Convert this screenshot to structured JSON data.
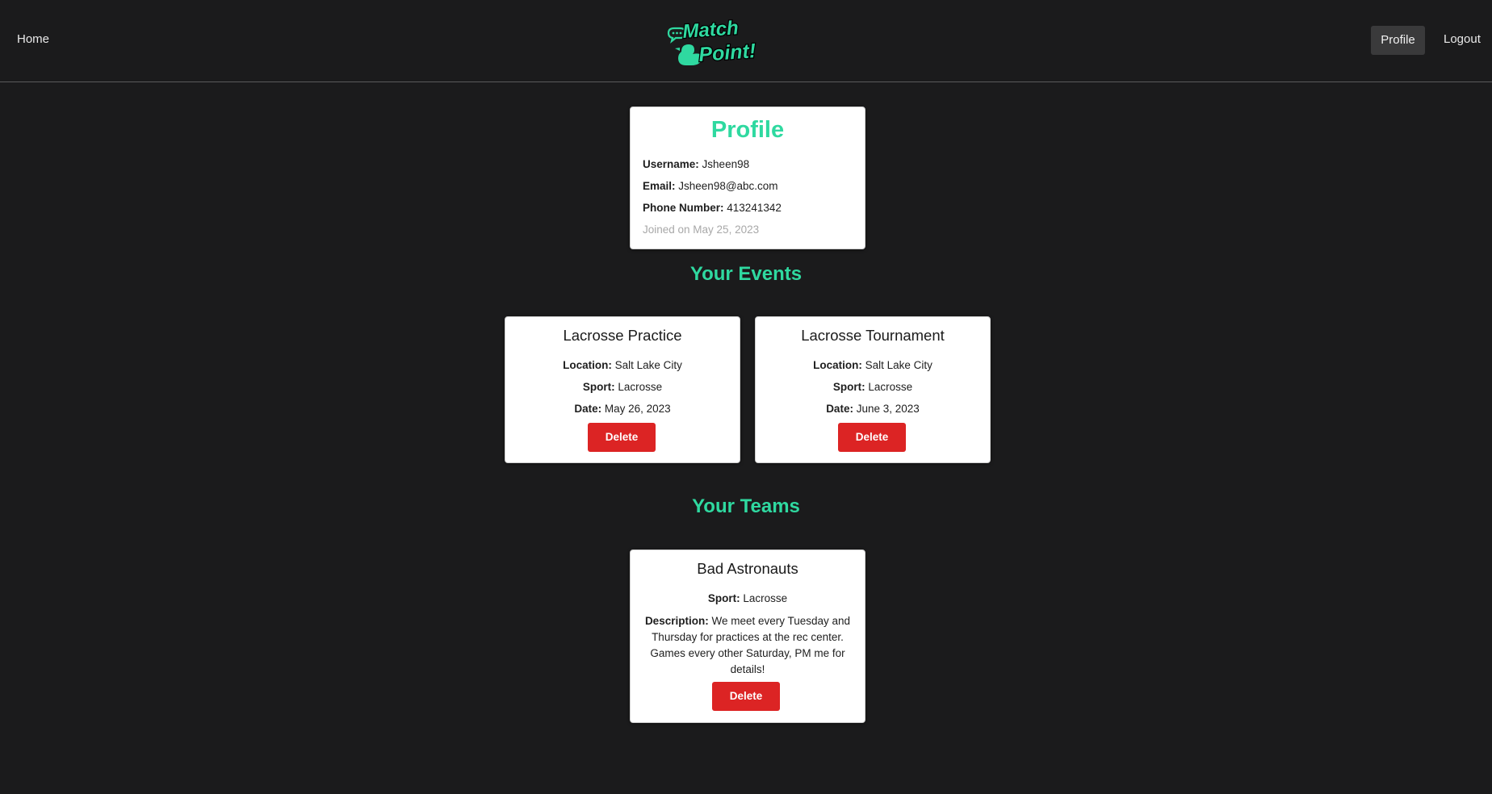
{
  "nav": {
    "home_label": "Home",
    "profile_label": "Profile",
    "logout_label": "Logout",
    "logo_text": "Match Point!"
  },
  "profile": {
    "title": "Profile",
    "username_label": "Username:",
    "username": "Jsheen98",
    "email_label": "Email:",
    "email": "Jsheen98@abc.com",
    "phone_label": "Phone Number:",
    "phone": "413241342",
    "joined": "Joined on May 25, 2023"
  },
  "events": {
    "section_title": "Your Events",
    "items": [
      {
        "title": "Lacrosse Practice",
        "location_label": "Location:",
        "location": "Salt Lake City",
        "sport_label": "Sport:",
        "sport": "Lacrosse",
        "date_label": "Date:",
        "date": "May 26, 2023",
        "delete_label": "Delete"
      },
      {
        "title": "Lacrosse Tournament",
        "location_label": "Location:",
        "location": "Salt Lake City",
        "sport_label": "Sport:",
        "sport": "Lacrosse",
        "date_label": "Date:",
        "date": "June 3, 2023",
        "delete_label": "Delete"
      }
    ]
  },
  "teams": {
    "section_title": "Your Teams",
    "items": [
      {
        "title": "Bad Astronauts",
        "sport_label": "Sport:",
        "sport": "Lacrosse",
        "description_label": "Description:",
        "description": "We meet every Tuesday and Thursday for practices at the rec center. Games every other Saturday, PM me for details!",
        "delete_label": "Delete"
      }
    ]
  },
  "colors": {
    "background": "#1b1b1c",
    "accent": "#2fd9a0",
    "delete": "#dc2424",
    "card": "#ffffff"
  }
}
